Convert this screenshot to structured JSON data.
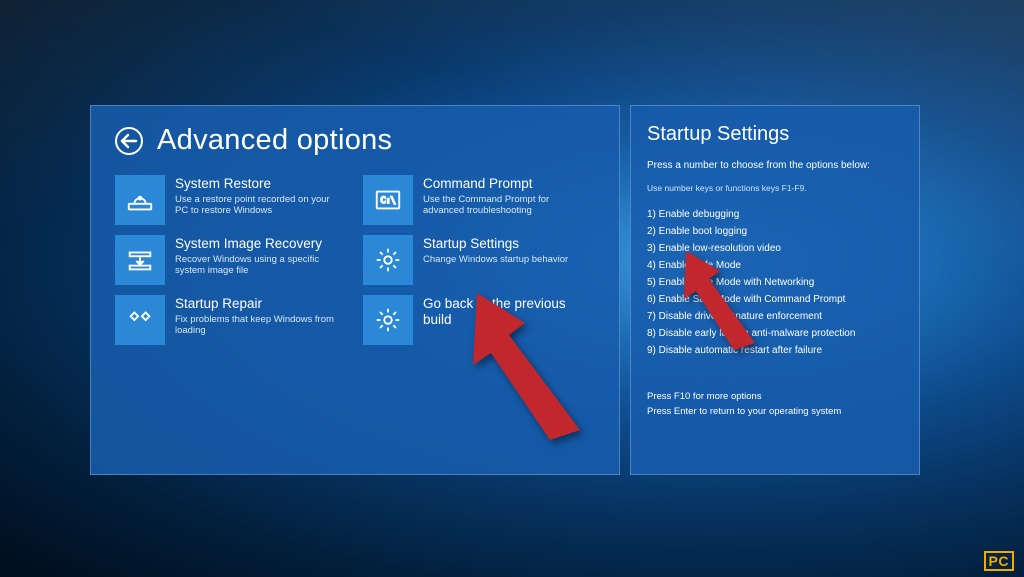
{
  "left": {
    "title": "Advanced options",
    "tiles": [
      {
        "title": "System Restore",
        "desc": "Use a restore point recorded on your PC to restore Windows"
      },
      {
        "title": "Command Prompt",
        "desc": "Use the Command Prompt for advanced troubleshooting"
      },
      {
        "title": "System Image Recovery",
        "desc": "Recover Windows using a specific system image file"
      },
      {
        "title": "Startup Settings",
        "desc": "Change Windows startup behavior"
      },
      {
        "title": "Startup Repair",
        "desc": "Fix problems that keep Windows from loading"
      },
      {
        "title": "Go back to the previous build",
        "desc": ""
      }
    ]
  },
  "right": {
    "title": "Startup Settings",
    "press": "Press a number to choose from the options below:",
    "hint": "Use number keys or functions keys F1-F9.",
    "items": [
      "1) Enable debugging",
      "2) Enable boot logging",
      "3) Enable low-resolution video",
      "4) Enable Safe Mode",
      "5) Enable Safe Mode with Networking",
      "6) Enable Safe Mode with Command Prompt",
      "7) Disable driver signature enforcement",
      "8) Disable early launch anti-malware protection",
      "9) Disable automatic restart after failure"
    ],
    "foot1": "Press F10 for more options",
    "foot2": "Press Enter to return to your operating system"
  },
  "watermark": {
    "pc": "PC",
    "rest": " "
  }
}
